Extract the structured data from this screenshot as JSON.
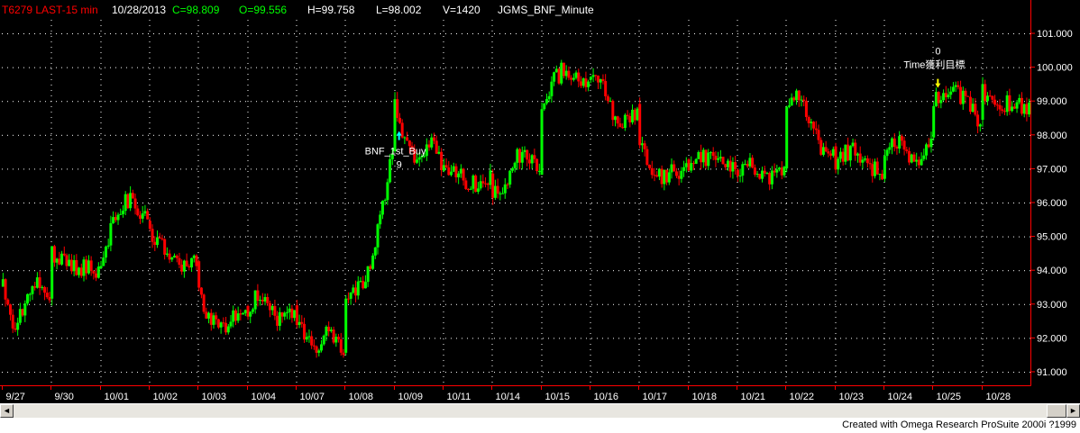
{
  "header": {
    "symbol": "T6279 LAST-15 min",
    "date": "10/28/2013",
    "close": "C=98.809",
    "open": "O=99.556",
    "high": "H=99.758",
    "low": "L=98.002",
    "volume": "V=1420",
    "indicator": "JGMS_BNF_Minute"
  },
  "colors": {
    "background": "#000000",
    "up_bar": "#00ff00",
    "down_bar": "#ff0000",
    "axis": "#ff0000",
    "grid": "#ffffff",
    "header_red": "#ff0000",
    "header_green": "#00ff00",
    "header_white": "#ffffff",
    "entry_arrow": "#00ffff",
    "exit_arrow": "#ffff00"
  },
  "chart_data": {
    "type": "candlestick",
    "title": "T6279 LAST-15 min",
    "x_tick_labels": [
      "9/27",
      "9/30",
      "10/01",
      "10/02",
      "10/03",
      "10/04",
      "10/07",
      "10/08",
      "10/09",
      "10/11",
      "10/14",
      "10/15",
      "10/16",
      "10/17",
      "10/18",
      "10/21",
      "10/22",
      "10/23",
      "10/24",
      "10/25",
      "10/28"
    ],
    "y_tick_labels": [
      "101.000",
      "100.000",
      "99.000",
      "98.000",
      "97.000",
      "96.000",
      "95.000",
      "94.000",
      "93.000",
      "92.000",
      "91.000"
    ],
    "ylim": [
      90.6,
      101.4
    ],
    "grid": true,
    "daily_path": [
      [
        93.6,
        92.1,
        93.2,
        93.8,
        93.0
      ],
      [
        94.5,
        94.1,
        94.0
      ],
      [
        94.2,
        95.8,
        96.1,
        95.4
      ],
      [
        95.1,
        94.7,
        94.3,
        94.1,
        94.3
      ],
      [
        93.3,
        92.5,
        92.3,
        92.6,
        92.9
      ],
      [
        92.8,
        93.4,
        92.7,
        92.5,
        92.9
      ],
      [
        92.6,
        91.7,
        92.1,
        91.6
      ],
      [
        93.0,
        93.4,
        94.1,
        95.6,
        97.6
      ],
      [
        98.8,
        97.6,
        97.1,
        97.9,
        97.2
      ],
      [
        96.9,
        96.8,
        96.5,
        96.7
      ],
      [
        96.2,
        96.5,
        97.4,
        97.5,
        96.8
      ],
      [
        98.6,
        99.6,
        100.0,
        99.6,
        99.4
      ],
      [
        99.7,
        99.4,
        98.6,
        98.3,
        98.6
      ],
      [
        97.9,
        96.7,
        96.9,
        97.0
      ],
      [
        97.1,
        97.3,
        97.2,
        97.1
      ],
      [
        97.0,
        97.1,
        96.8,
        96.8,
        96.9
      ],
      [
        98.6,
        99.2,
        98.5,
        97.5,
        97.6
      ],
      [
        97.2,
        97.6,
        97.1,
        96.9
      ],
      [
        97.6,
        97.8,
        97.5,
        97.1,
        97.8
      ],
      [
        99.1,
        99.3,
        99.2,
        99.0,
        98.3
      ],
      [
        99.3,
        98.9,
        98.8
      ]
    ],
    "markers": [
      {
        "label": "BNF_1st_Buy",
        "sub": "9",
        "date": "10/09",
        "price": 97.9,
        "direction": "up"
      },
      {
        "label": "Time獲利目標",
        "sub": "0",
        "date": "10/25",
        "price": 99.6,
        "direction": "down"
      }
    ]
  },
  "scrollbar": {
    "left_arrow": "◄",
    "right_arrow": "►"
  },
  "footer": {
    "credit": "Created with Omega Research ProSuite 2000i ?1999"
  }
}
